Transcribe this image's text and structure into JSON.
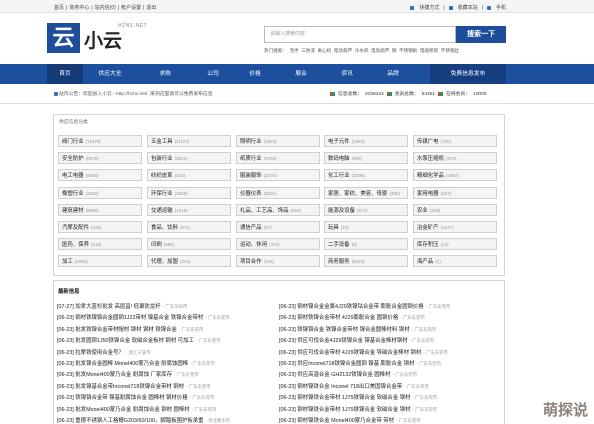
{
  "topbar": {
    "left": [
      "首页",
      "|",
      "商务中心",
      "|",
      "站内信(0)",
      "|",
      "帐户设置",
      "|",
      "退出"
    ],
    "right": [
      "快捷方式",
      "|",
      "收藏本站",
      "|",
      "手机"
    ]
  },
  "brand": {
    "logo_char": "云",
    "name": "小云",
    "sub": "HZNX.NET"
  },
  "search": {
    "placeholder": "请输入搜索内容",
    "button": "搜索一下",
    "hot_label": "热门搜索：",
    "hot": [
      "泡手",
      "三防漆",
      "离心机",
      "电动葫芦",
      "冷水机",
      "电动葫芦",
      "钢",
      "不锈钢板",
      "电缆桥架",
      "不锈钢丝"
    ]
  },
  "nav": {
    "items": [
      "首页",
      "供应大全",
      "求购",
      "公司",
      "价格",
      "展会",
      "资讯",
      "品牌"
    ],
    "right": "免费信息发布"
  },
  "info": {
    "message": "站内公告：欢迎加入小云 - http://hznx.net/ ,来到这里就可以免费发布信息",
    "stats": [
      "信息总数：",
      "3159423",
      "会员总数：",
      "64351",
      "在线会员：",
      "10000"
    ]
  },
  "categories": {
    "title": "供应信息分类",
    "items": [
      {
        "name": "阀门行业",
        "count": "(11579)"
      },
      {
        "name": "五金工具",
        "count": "(11107)"
      },
      {
        "name": "照明行业",
        "count": "(2629)"
      },
      {
        "name": "电子元件",
        "count": "(1583)"
      },
      {
        "name": "传媒广电",
        "count": "(705)"
      },
      {
        "name": "安全防护",
        "count": "(6076)"
      },
      {
        "name": "包装行业",
        "count": "(5613)"
      },
      {
        "name": "纸质行业",
        "count": "(3756)"
      },
      {
        "name": "数码电脑",
        "count": "(998)"
      },
      {
        "name": "水泵压缩机",
        "count": "(573)"
      },
      {
        "name": "电工电器",
        "count": "(6638)"
      },
      {
        "name": "纺织皮革",
        "count": "(453)"
      },
      {
        "name": "服装服饰",
        "count": "(2470)"
      },
      {
        "name": "化工行业",
        "count": "(2398)"
      },
      {
        "name": "精细化学品",
        "count": "(4567)"
      },
      {
        "name": "橡塑行业",
        "count": "(2549)"
      },
      {
        "name": "环保行业",
        "count": "(2549)"
      },
      {
        "name": "仪器仪表",
        "count": "(8531)"
      },
      {
        "name": "家居、家纺、美容、母婴",
        "count": "(380)"
      },
      {
        "name": "家用电器",
        "count": "(627)"
      },
      {
        "name": "建筑建材",
        "count": "(8686)"
      },
      {
        "name": "交通运输",
        "count": "(1915)"
      },
      {
        "name": "礼品、工艺品、饰品",
        "count": "(554)"
      },
      {
        "name": "能源及设备",
        "count": "(672)"
      },
      {
        "name": "农业",
        "count": "(426)"
      },
      {
        "name": "汽摩及配件",
        "count": "(435)"
      },
      {
        "name": "食品、饮料",
        "count": "(571)"
      },
      {
        "name": "通信产品",
        "count": "(97)"
      },
      {
        "name": "玩具",
        "count": "(19)"
      },
      {
        "name": "冶金矿产",
        "count": "(4247)"
      },
      {
        "name": "医药、保养",
        "count": "(519)"
      },
      {
        "name": "印刷",
        "count": "(665)"
      },
      {
        "name": "运动、休闲",
        "count": "(370)"
      },
      {
        "name": "二手设备",
        "count": "(5)"
      },
      {
        "name": "库存积压",
        "count": "(13)"
      },
      {
        "name": "加工",
        "count": "(3484)"
      },
      {
        "name": "代理、加盟",
        "count": "(234)"
      },
      {
        "name": "项目合作",
        "count": "(102)"
      },
      {
        "name": "商务服务",
        "count": "(5023)"
      },
      {
        "name": "海产品",
        "count": "(1)"
      }
    ]
  },
  "news": {
    "title": "最新信息",
    "left": [
      {
        "date": "[07-27]",
        "text": "加拿大蓝杉批发 高层昌! 低聚防龙杆",
        "loc": "- 广东深圳市"
      },
      {
        "date": "[06-23]",
        "text": "钢材铁镍铬合金圆钢1J22带材 镍基合金 铁镍合金带材",
        "loc": "- 广东东莞市"
      },
      {
        "date": "[06-23]",
        "text": "批发铁镍合金带材帽材 钢材 钢材 铁镍合金",
        "loc": "- 广东东莞市"
      },
      {
        "date": "[06-23]",
        "text": "批发圆钢1J50铁镍合金 软磁合金板材 钢材 可加工",
        "loc": "- 广东东莞市"
      },
      {
        "date": "[06-23]",
        "text": "拉摩铁使用合金号？",
        "loc": "- 浙江宁波市"
      },
      {
        "date": "[06-23]",
        "text": "批发镍合金圆棒 Monel400蒙乃合金 耐腐蚀圆棒",
        "loc": "- 广东东莞市"
      },
      {
        "date": "[06-23]",
        "text": "批发Monel400蒙乃合金 耐腐蚀 厂家库存",
        "loc": "- 广东东莞市"
      },
      {
        "date": "[06-23]",
        "text": "批发镍基合金带Inconel718铁镍合金带材 钢材",
        "loc": "- 广东东莞市"
      },
      {
        "date": "[06-23]",
        "text": "铁镍铬合金带 镍基耐腐蚀合金 圆棒材 钢材价格",
        "loc": "- 广东东莞市"
      },
      {
        "date": "[06-23]",
        "text": "批发Monel400蒙乃合金 耐腐蚀合金 钢材 圆棒材",
        "loc": "- 广东东莞市"
      },
      {
        "date": "[06-23]",
        "text": "重德不锈钢人工格栅G203/60/100，脚踏板围护板承重",
        "loc": "- 河北衡水市"
      }
    ],
    "right": [
      {
        "date": "[06-23]",
        "text": "钢材镍合金金属4J29铁镍钴合金带 膨胀合金圆钢价格",
        "loc": "- 广东东莞市"
      },
      {
        "date": "[06-23]",
        "text": "钢材铁镍合金带材 4J29膨胀合金 圆钢价格",
        "loc": "- 广东东莞市"
      },
      {
        "date": "[06-23]",
        "text": "铁镍铬合金 铁镍合金带材 镍合金圆棒材料 钢材",
        "loc": "- 广东东莞市"
      },
      {
        "date": "[06-23]",
        "text": "供应可伐合金4J29铁镍合金 镍基合金棒材钢材",
        "loc": "- 广东东莞市"
      },
      {
        "date": "[06-23]",
        "text": "供应可伐合金带材 4J29铁镍合金 导磁合金棒材 钢材",
        "loc": "- 广东东莞市"
      },
      {
        "date": "[06-23]",
        "text": "供应Inconel718铁镍合金圆钢 镍基 膨胀合金 钢材",
        "loc": "- 广东东莞市"
      },
      {
        "date": "[06-23]",
        "text": "供应高温合金 GH2132铁镍合金 圆棒材",
        "loc": "- 广东东莞市"
      },
      {
        "date": "[06-23]",
        "text": "钢材镍铁合金 Inconel 718出口美国镍合金带",
        "loc": "- 广东东莞市"
      },
      {
        "date": "[06-23]",
        "text": "钢材镍铁合金带材 1J79铁镍合金 软磁合金 钢材",
        "loc": "- 广东东莞市"
      },
      {
        "date": "[06-23]",
        "text": "钢材镍铁合金带材 1J79铁镍合金 软磁合金 钢材",
        "loc": "- 广东东莞市"
      },
      {
        "date": "[06-23]",
        "text": "钢材镍铁合金 Monel400蒙乃合金带 带材",
        "loc": "- 广东东莞市"
      }
    ]
  },
  "watermark": "萌探说"
}
